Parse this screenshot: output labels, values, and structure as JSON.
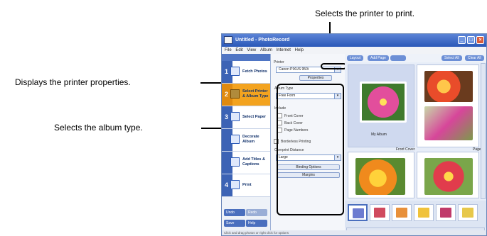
{
  "callouts": {
    "printer": "Selects the printer to print.",
    "properties": "Displays the printer properties.",
    "album_type": "Selects the album type."
  },
  "window": {
    "title": "Untitled - PhotoRecord",
    "menu": [
      "File",
      "Edit",
      "View",
      "Album",
      "Internet",
      "Help"
    ]
  },
  "steps": [
    {
      "num": "1",
      "label": "Fetch Photos"
    },
    {
      "num": "2",
      "label": "Select Printer & Album Type"
    },
    {
      "num": "3",
      "label": "Select Paper"
    },
    {
      "num": "",
      "label": "Decorate Album"
    },
    {
      "num": "",
      "label": "Add Titles & Captions"
    },
    {
      "num": "4",
      "label": "Print"
    }
  ],
  "bottom_buttons": {
    "undo": "Undo",
    "redo": "Redo",
    "save": "Save",
    "help": "Help"
  },
  "settings": {
    "printer_caption": "Printer",
    "printer_value": "Canon PIXUS 950i",
    "properties_button": "Properties",
    "album_type_caption": "Album Type",
    "album_type_value": "Free Form",
    "include_caption": "Include",
    "include_options": [
      "Front Cover",
      "Back Cover",
      "Page Numbers"
    ],
    "borderless": "Borderless Printing",
    "overprint_caption": "Overprint Distance",
    "overprint_value": "Large",
    "binding_button": "Binding Options",
    "margins_button": "Margins"
  },
  "layout": {
    "buttons": [
      "Layout",
      "Add Page"
    ],
    "right_buttons": [
      "Select All",
      "Clear All"
    ],
    "album_title": "My Album",
    "front_cover": "Front Cover",
    "page_label": "Page"
  },
  "status_text": "Click and drag photos or right click for options",
  "colors": {
    "titlebar": "#2a58b8",
    "active_step": "#f3a31f",
    "callout_line": "#000000"
  }
}
